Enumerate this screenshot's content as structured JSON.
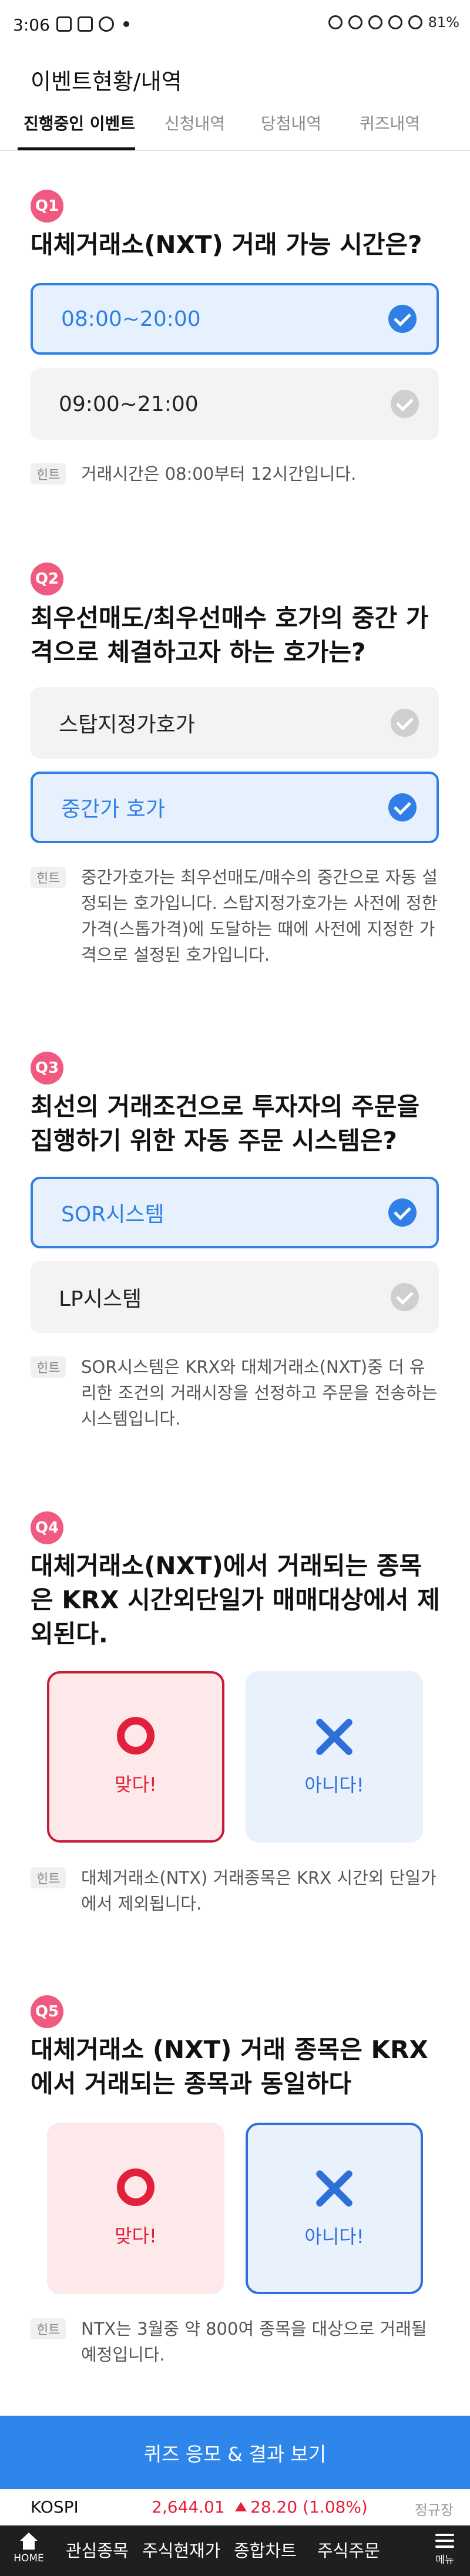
{
  "status_bar": {
    "time": "3:06",
    "battery": "81%"
  },
  "header": {
    "title": "이벤트현황/내역"
  },
  "tabs": [
    {
      "label": "진행중인 이벤트",
      "active": true
    },
    {
      "label": "신청내역",
      "active": false
    },
    {
      "label": "당첨내역",
      "active": false
    },
    {
      "label": "퀴즈내역",
      "active": false
    }
  ],
  "questions": [
    {
      "number": "Q1",
      "text": "대체거래소(NXT) 거래 가능 시간은?",
      "options": [
        {
          "label": "08:00~20:00",
          "selected": true
        },
        {
          "label": "09:00~21:00",
          "selected": false
        }
      ],
      "hint_tag": "힌트",
      "hint": "거래시간은 08:00부터 12시간입니다."
    },
    {
      "number": "Q2",
      "text": "최우선매도/최우선매수 호가의 중간 가격으로 체결하고자 하는 호가는?",
      "options": [
        {
          "label": "스탑지정가호가",
          "selected": false
        },
        {
          "label": "중간가 호가",
          "selected": true
        }
      ],
      "hint_tag": "힌트",
      "hint": "중간가호가는 최우선매도/매수의 중간으로 자동 설정되는 호가입니다. 스탑지정가호가는 사전에 정한 가격(스톱가격)에 도달하는 때에 사전에 지정한 가격으로 설정된 호가입니다."
    },
    {
      "number": "Q3",
      "text": "최선의 거래조건으로 투자자의 주문을 집행하기 위한 자동 주문 시스템은?",
      "options": [
        {
          "label": "SOR시스템",
          "selected": true
        },
        {
          "label": "LP시스템",
          "selected": false
        }
      ],
      "hint_tag": "힌트",
      "hint": "SOR시스템은 KRX와 대체거래소(NXT)중 더 유리한 조건의 거래시장을 선정하고 주문을 전송하는 시스템입니다."
    },
    {
      "number": "Q4",
      "text": "대체거래소(NXT)에서 거래되는 종목은 KRX 시간외단일가 매매대상에서 제외된다.",
      "o_label": "맞다!",
      "x_label": "아니다!",
      "answer": "o",
      "hint_tag": "힌트",
      "hint": "대체거래소(NTX) 거래종목은 KRX 시간외 단일가에서 제외됩니다."
    },
    {
      "number": "Q5",
      "text": "대체거래소 (NXT) 거래 종목은 KRX에서 거래되는 종목과 동일하다",
      "o_label": "맞다!",
      "x_label": "아니다!",
      "answer": "x",
      "hint_tag": "힌트",
      "hint": "NTX는 3월중 약 800여 종목을 대상으로 거래될 예정입니다."
    }
  ],
  "submit": {
    "label": "퀴즈 응모 & 결과 보기"
  },
  "ticker": {
    "name": "KOSPI",
    "price": "2,644.01",
    "change": "28.20 (1.08%)",
    "session": "정규장"
  },
  "bottom_nav": {
    "home_label": "HOME",
    "items": [
      "관심종목",
      "주식현재가",
      "종합차트",
      "주식주문"
    ],
    "menu_label": "메뉴"
  },
  "colors": {
    "accent_blue": "#2f7fe6",
    "badge_pink": "#f05a7e",
    "o_red": "#e3203b",
    "submit_blue": "#2f86ea"
  }
}
